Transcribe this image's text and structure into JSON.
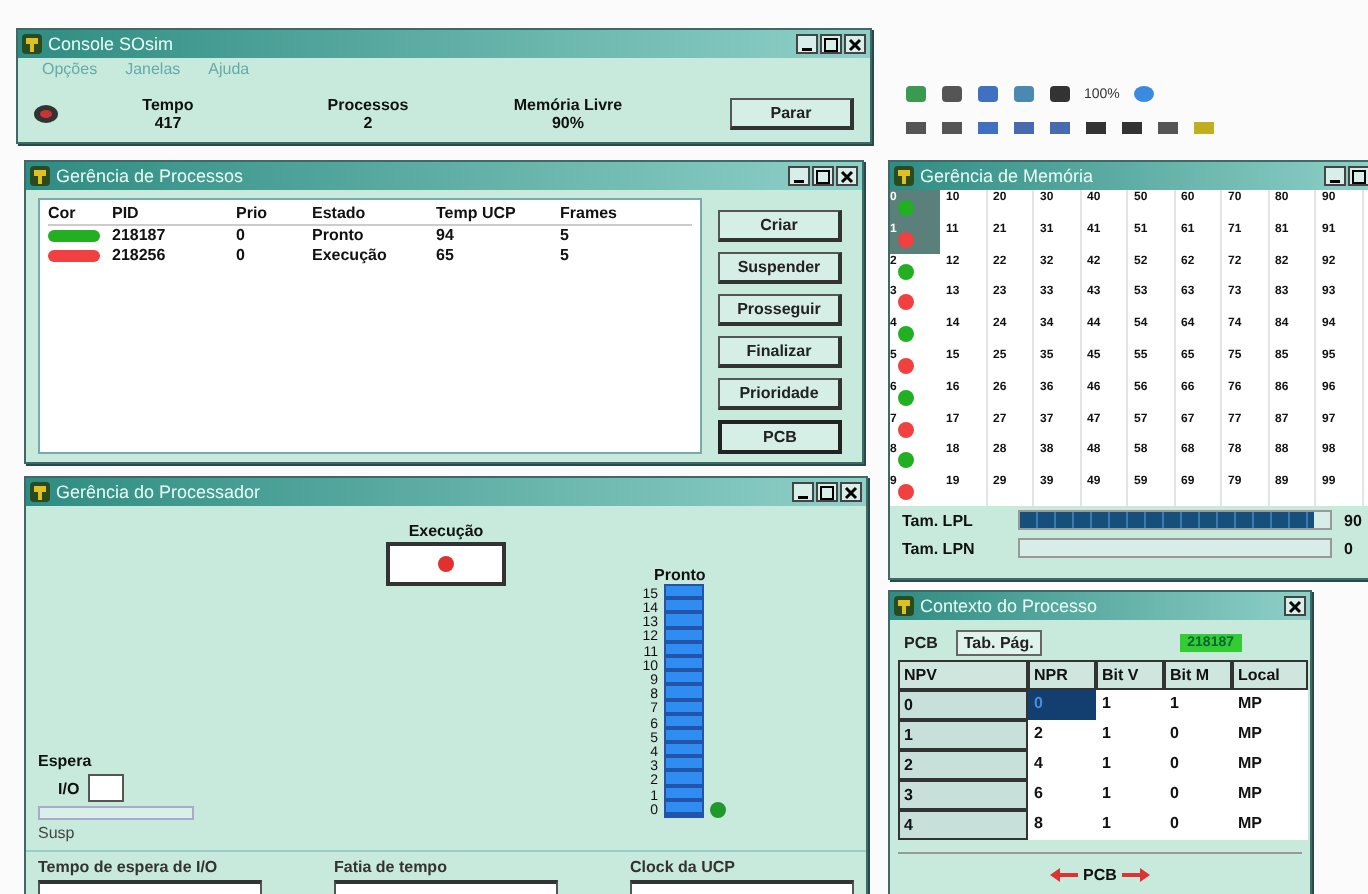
{
  "toolbar": {
    "zoom": "100%"
  },
  "console": {
    "title": "Console SOsim",
    "menu": [
      "Opções",
      "Janelas",
      "Ajuda"
    ],
    "stats": [
      {
        "label": "Tempo",
        "value": "417"
      },
      {
        "label": "Processos",
        "value": "2"
      },
      {
        "label": "Memória Livre",
        "value": "90%"
      }
    ],
    "button": "Parar"
  },
  "processes": {
    "title": "Gerência de Processos",
    "columns": [
      "Cor",
      "PID",
      "Prio",
      "Estado",
      "Temp UCP",
      "Frames"
    ],
    "rows": [
      {
        "color": "#22b022",
        "pid": "218187",
        "prio": "0",
        "state": "Pronto",
        "cpu_time": "94",
        "frames": "5"
      },
      {
        "color": "#f04040",
        "pid": "218256",
        "prio": "0",
        "state": "Execução",
        "cpu_time": "65",
        "frames": "5"
      }
    ],
    "buttons": [
      {
        "label": "Criar",
        "selected": false
      },
      {
        "label": "Suspender",
        "selected": false
      },
      {
        "label": "Prosseguir",
        "selected": false
      },
      {
        "label": "Finalizar",
        "selected": false
      },
      {
        "label": "Prioridade",
        "selected": false
      },
      {
        "label": "PCB",
        "selected": true
      }
    ]
  },
  "processor": {
    "title": "Gerência do Processador",
    "running_label": "Execução",
    "running": {
      "color": "#e03030"
    },
    "ready_label": "Pronto",
    "ready_slots": [
      "15",
      "14",
      "13",
      "12",
      "11",
      "10",
      "9",
      "8",
      "7",
      "6",
      "5",
      "4",
      "3",
      "2",
      "1",
      "0"
    ],
    "ready_queue": [
      {
        "color": "#1f9a2a"
      }
    ],
    "wait_label": "Espera",
    "io_label": "I/O",
    "susp_label": "Susp",
    "sliders": [
      {
        "label": "Tempo de espera de I/O"
      },
      {
        "label": "Fatia de tempo"
      },
      {
        "label": "Clock da UCP"
      }
    ]
  },
  "memory": {
    "title": "Gerência de Memória",
    "frames": [
      {
        "number": "0",
        "color": "#22b022",
        "selected": true,
        "cells": [
          "10",
          "20",
          "30",
          "40",
          "50",
          "60",
          "70",
          "80",
          "90"
        ]
      },
      {
        "number": "1",
        "color": "#f04040",
        "selected": true,
        "cells": [
          "11",
          "21",
          "31",
          "41",
          "51",
          "61",
          "71",
          "81",
          "91"
        ]
      },
      {
        "number": "2",
        "color": "#22b022",
        "selected": false,
        "cells": [
          "12",
          "22",
          "32",
          "42",
          "52",
          "62",
          "72",
          "82",
          "92"
        ]
      },
      {
        "number": "3",
        "color": "#f04040",
        "selected": false,
        "cells": [
          "13",
          "23",
          "33",
          "43",
          "53",
          "63",
          "73",
          "83",
          "93"
        ]
      },
      {
        "number": "4",
        "color": "#22b022",
        "selected": false,
        "cells": [
          "14",
          "24",
          "34",
          "44",
          "54",
          "64",
          "74",
          "84",
          "94"
        ]
      },
      {
        "number": "5",
        "color": "#f04040",
        "selected": false,
        "cells": [
          "15",
          "25",
          "35",
          "45",
          "55",
          "65",
          "75",
          "85",
          "95"
        ]
      },
      {
        "number": "6",
        "color": "#22b022",
        "selected": false,
        "cells": [
          "16",
          "26",
          "36",
          "46",
          "56",
          "66",
          "76",
          "86",
          "96"
        ]
      },
      {
        "number": "7",
        "color": "#f04040",
        "selected": false,
        "cells": [
          "17",
          "27",
          "37",
          "47",
          "57",
          "67",
          "77",
          "87",
          "97"
        ]
      },
      {
        "number": "8",
        "color": "#22b022",
        "selected": false,
        "cells": [
          "18",
          "28",
          "38",
          "48",
          "58",
          "68",
          "78",
          "88",
          "98"
        ]
      },
      {
        "number": "9",
        "color": "#f04040",
        "selected": false,
        "cells": [
          "19",
          "29",
          "39",
          "49",
          "59",
          "69",
          "79",
          "89",
          "99"
        ]
      }
    ],
    "queues": [
      {
        "label": "Tam. LPL",
        "level": 0.95,
        "value": "90"
      },
      {
        "label": "Tam. LPN",
        "level": 0,
        "value": "0"
      }
    ]
  },
  "context": {
    "title": "Contexto do Processo",
    "tabs": [
      {
        "label": "PCB",
        "selected": false
      },
      {
        "label": "Tab. Pág.",
        "selected": true
      }
    ],
    "pid": "218187",
    "columns": [
      "NPV",
      "NPR",
      "Bit V",
      "Bit M",
      "Local"
    ],
    "rows": [
      {
        "npv": "0",
        "npr": "0",
        "bit_v": "1",
        "bit_m": "1",
        "local": "MP",
        "selected": true
      },
      {
        "npv": "1",
        "npr": "2",
        "bit_v": "1",
        "bit_m": "0",
        "local": "MP",
        "selected": false
      },
      {
        "npv": "2",
        "npr": "4",
        "bit_v": "1",
        "bit_m": "0",
        "local": "MP",
        "selected": false
      },
      {
        "npv": "3",
        "npr": "6",
        "bit_v": "1",
        "bit_m": "0",
        "local": "MP",
        "selected": false
      },
      {
        "npv": "4",
        "npr": "8",
        "bit_v": "1",
        "bit_m": "0",
        "local": "MP",
        "selected": false
      }
    ],
    "footer": "PCB"
  }
}
